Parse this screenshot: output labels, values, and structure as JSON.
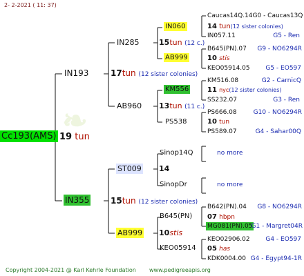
{
  "date": "2-  2-2021  ( 11:  37)",
  "footer": {
    "copyright": "Copyright 2004-2021 @ Karl Kehrle Foundation",
    "url": "www.pedigreeapis.org"
  },
  "colors": {
    "line": "#111111",
    "green_highlight": "#00e000",
    "yellow_highlight": "#ffff33",
    "red_text": "#b01000",
    "blue_text": "#1a2ab0"
  },
  "root": {
    "name": "Cc193(AMS)",
    "number": "19",
    "breeder": "tun"
  },
  "gen1": {
    "sire": {
      "name": "IN193",
      "number": "17",
      "breeder": "tun",
      "note": "(12 sister colonies)"
    },
    "dam": {
      "name": "IN355",
      "number": "15",
      "breeder": "tun",
      "note": "(12 sister colonies)"
    }
  },
  "gen2": {
    "ss": {
      "name": "IN285",
      "number": "15",
      "breeder": "tun",
      "note": "(12 c.)"
    },
    "sd": {
      "name": "AB960",
      "number": "13",
      "breeder": "tun",
      "note": "(11 c.)"
    },
    "ds": {
      "name": "ST009",
      "number": "14"
    },
    "dd": {
      "name": "AB999",
      "number": "10",
      "breeder": "stis"
    }
  },
  "gen3": {
    "sss": {
      "name": "IN060",
      "number": "14",
      "breeder": "tun",
      "note": "(12 sister colonies)"
    },
    "ssd": {
      "name": "AB999",
      "number": "10",
      "breeder": "stis"
    },
    "sds": {
      "name": "KM556",
      "number": "11",
      "breeder": "nyc",
      "note": "(12 sister colonies)"
    },
    "sdd": {
      "name": "PS538",
      "number": "10",
      "breeder": "tun"
    },
    "dss": {
      "name": "Sinop14Q",
      "more": "no more"
    },
    "dsd": {
      "name": "SinopDr",
      "more": "no more"
    },
    "dds": {
      "name": "B645(PN)",
      "number": "07",
      "breeder": "hbpn"
    },
    "ddd": {
      "name": "KEO05914",
      "number": "05",
      "breeder": "has"
    }
  },
  "gen4": [
    {
      "name": "Caucas14Q.14G0 - Caucas13Q",
      "ref": ""
    },
    {
      "name": "IN057.11",
      "ref": "G5 - Ren"
    },
    {
      "name": "B645(PN).07",
      "ref": "G9 - NO6294R"
    },
    {
      "name": "KEO05914.05",
      "ref": "G5 - EO597"
    },
    {
      "name": "KM516.08",
      "ref": "G2 - CarnicQ"
    },
    {
      "name": "SS232.07",
      "ref": "G3 - Ren"
    },
    {
      "name": "PS666.08",
      "ref": "G10 - NO6294R"
    },
    {
      "name": "PS589.07",
      "ref": "G4 - Sahar00Q"
    },
    {
      "name": "B642(PN).04",
      "ref": "G8 - NO6294R"
    },
    {
      "name": "MG081(PN).05",
      "ref": "G1 - Margret04R"
    },
    {
      "name": "KEO02906.02",
      "ref": "G4 - EO597"
    },
    {
      "name": "KDK0004.00",
      "ref": "G4 - Egypt94-1R"
    }
  ]
}
